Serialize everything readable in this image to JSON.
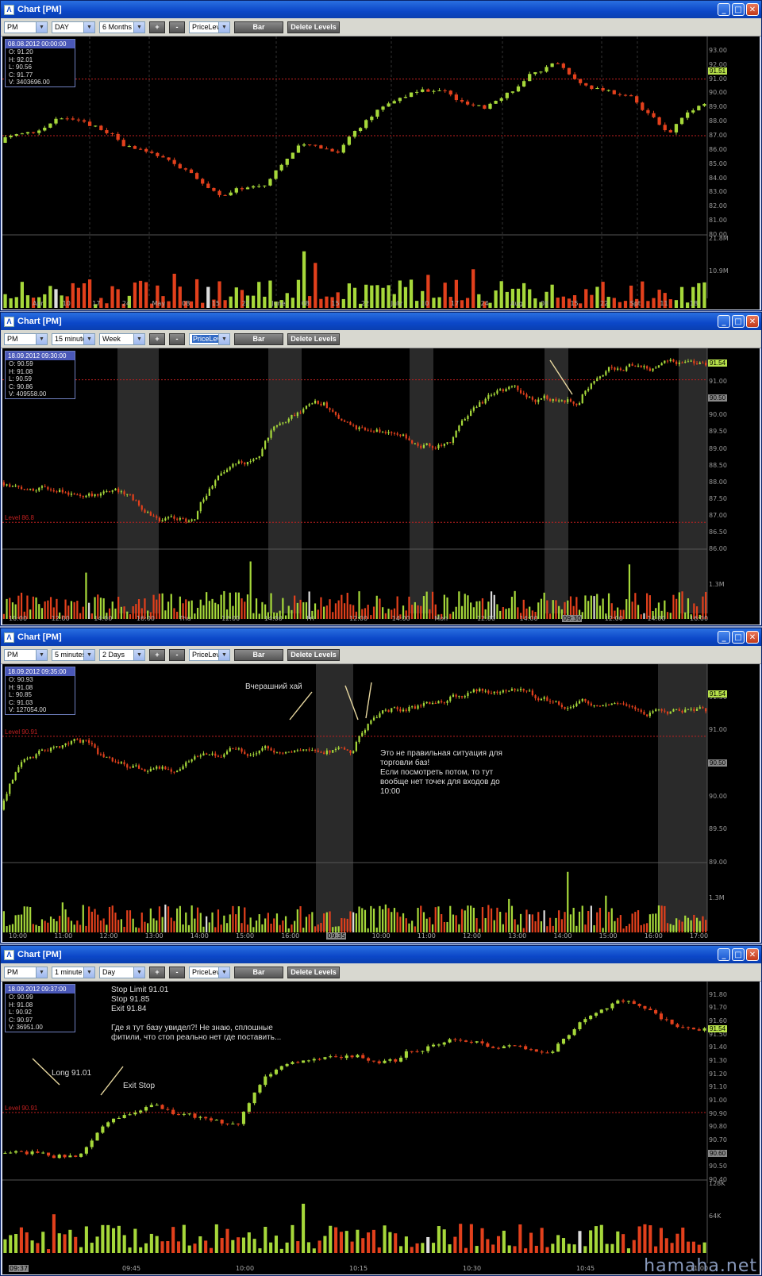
{
  "windows": [
    {
      "title": "Chart [PM]",
      "symbol": "PM",
      "interval": "DAY",
      "range": "6 Months",
      "tool": "PriceLeve",
      "bar_label": "Bar",
      "delete_label": "Delete Levels",
      "plus": "+",
      "minus": "-",
      "info": {
        "date": "08.08.2012 00:00:00",
        "o": "O: 91.20",
        "h": "H: 92.01",
        "l": "L: 90.56",
        "c": "C: 91.77",
        "v": "V: 3403696.00"
      },
      "yaxis": [
        "94.00",
        "93.00",
        "92.00",
        "91.00",
        "90.00",
        "89.00",
        "88.00",
        "87.00",
        "86.00",
        "85.00",
        "84.00",
        "83.00",
        "82.00",
        "81.00",
        "80.00"
      ],
      "price_tag": "91.51",
      "vol_labels": [
        "21.8M",
        "10.9M"
      ],
      "xaxis": [
        "Apr",
        "10",
        "17",
        "24",
        "May",
        "08",
        "15",
        "22",
        "June",
        "08",
        "15",
        "22",
        "July",
        "10",
        "17",
        "24",
        "Aug",
        "08",
        "15",
        "22",
        "Spt",
        "11",
        "18"
      ]
    },
    {
      "title": "Chart [PM]",
      "symbol": "PM",
      "interval": "15 minutes",
      "range": "Week",
      "tool": "PriceLeve",
      "bar_label": "Bar",
      "delete_label": "Delete Levels",
      "plus": "+",
      "minus": "-",
      "info": {
        "date": "18.09.2012 09:30:00",
        "o": "O: 90.59",
        "h": "H: 91.08",
        "l": "L: 90.59",
        "c": "C: 90.86",
        "v": "V: 409558.00"
      },
      "yaxis": [
        "92.00",
        "91.50",
        "91.00",
        "90.50",
        "90.00",
        "89.50",
        "89.00",
        "88.50",
        "88.00",
        "87.50",
        "87.00",
        "86.50",
        "86.00"
      ],
      "price_tag": "91.54",
      "grey_tag": "90.50",
      "level_label": "Level 86.8",
      "vol_labels": [
        "1.3M"
      ],
      "xaxis": [
        "10:00",
        "12:00",
        "14:00",
        "16:00",
        "Thu",
        "12:00",
        "14:00",
        "Fri",
        "12:00",
        "14:00",
        "Mon",
        "12:00",
        "14:00",
        "09:30",
        "12:00",
        "14:00",
        "16:00"
      ]
    },
    {
      "title": "Chart [PM]",
      "symbol": "PM",
      "interval": "5 minutes",
      "range": "2 Days",
      "tool": "PriceLeve",
      "bar_label": "Bar",
      "delete_label": "Delete Levels",
      "plus": "+",
      "minus": "-",
      "info": {
        "date": "18.09.2012 09:35:00",
        "o": "O: 90.93",
        "h": "H: 91.08",
        "l": "L: 90.85",
        "c": "C: 91.03",
        "v": "V: 127054.00"
      },
      "yaxis": [
        "92.00",
        "91.50",
        "91.00",
        "90.50",
        "90.00",
        "89.50",
        "89.00"
      ],
      "price_tag": "91.54",
      "grey_tag": "90.50",
      "level_label": "Level 90.91",
      "vol_labels": [
        "1.3M"
      ],
      "annotation1": "Вчерашний хай",
      "annotation2": "Это не правильная ситуация для\nторговли баз!\nЕсли посмотреть потом, то тут\nвообще нет точек для входов до\n10:00",
      "xaxis": [
        "10:00",
        "11:00",
        "12:00",
        "13:00",
        "14:00",
        "15:00",
        "16:00",
        "09:35",
        "10:00",
        "11:00",
        "12:00",
        "13:00",
        "14:00",
        "15:00",
        "16:00",
        "17:00"
      ]
    },
    {
      "title": "Chart [PM]",
      "symbol": "PM",
      "interval": "1 minute",
      "range": "Day",
      "tool": "PriceLeve",
      "bar_label": "Bar",
      "delete_label": "Delete Levels",
      "plus": "+",
      "minus": "-",
      "info": {
        "date": "18.09.2012 09:37:00",
        "o": "O: 90.99",
        "h": "H: 91.08",
        "l": "L: 90.92",
        "c": "C: 90.97",
        "v": "V: 36951.00"
      },
      "yaxis": [
        "91.90",
        "91.80",
        "91.70",
        "91.60",
        "91.50",
        "91.40",
        "91.30",
        "91.20",
        "91.10",
        "91.00",
        "90.90",
        "90.80",
        "90.70",
        "90.60",
        "90.50",
        "90.40"
      ],
      "price_tag": "91.54",
      "grey_tag": "90.60",
      "level_label": "Level 90.91",
      "vol_labels": [
        "128K",
        "64K"
      ],
      "annotation1": "Stop Limit 91.01\nStop 91.85\nExit 91.84\n\nГде я тут базу увидел?! Не знаю, сплошные\nфитили, что стоп реально нет где поставить...",
      "annotation_long": "Long 91.01",
      "annotation_exit": "Exit Stop",
      "xaxis": [
        "09:37",
        "09:45",
        "10:00",
        "10:15",
        "10:30",
        "10:45",
        "11:00"
      ]
    }
  ],
  "watermark": "hamaha.net",
  "colors": {
    "up": "#a6d83a",
    "down": "#e2401c",
    "level": "#c02020",
    "session": "#2a2a2a"
  }
}
